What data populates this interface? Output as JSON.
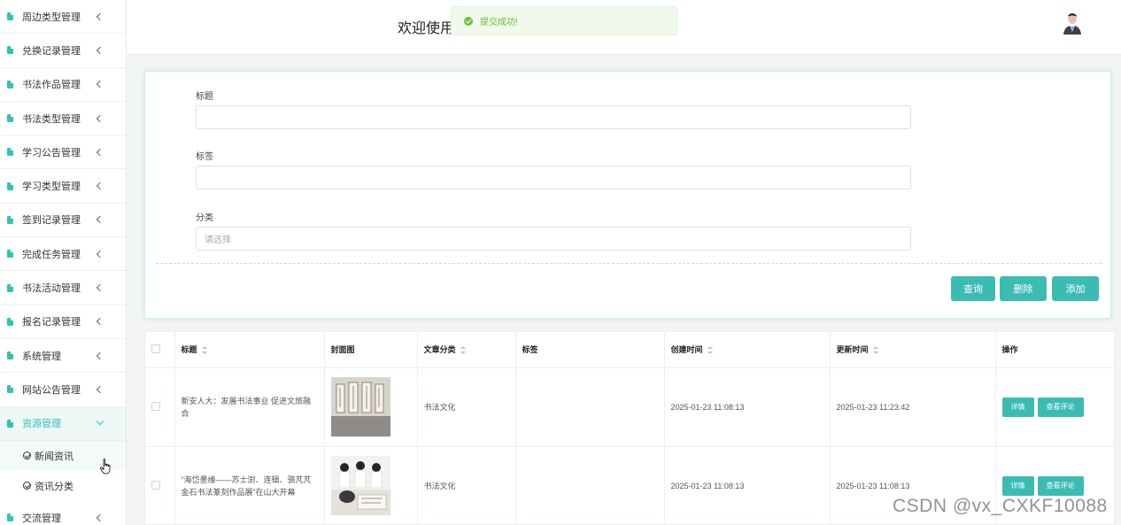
{
  "sidebar": {
    "items": [
      {
        "label": "周边类型管理"
      },
      {
        "label": "兑换记录管理"
      },
      {
        "label": "书法作品管理"
      },
      {
        "label": "书法类型管理"
      },
      {
        "label": "学习公告管理"
      },
      {
        "label": "学习类型管理"
      },
      {
        "label": "签到记录管理"
      },
      {
        "label": "完成任务管理"
      },
      {
        "label": "书法活动管理"
      },
      {
        "label": "报名记录管理"
      },
      {
        "label": "系统管理"
      },
      {
        "label": "网站公告管理"
      },
      {
        "label": "资源管理"
      },
      {
        "label": "交流管理"
      }
    ],
    "sub_items": [
      {
        "label": "新闻资讯"
      },
      {
        "label": "资讯分类"
      }
    ]
  },
  "header": {
    "welcome": "欢迎使用",
    "toast": "提交成功!"
  },
  "search": {
    "title_label": "标题",
    "tag_label": "标签",
    "category_label": "分类",
    "category_placeholder": "请选择",
    "query_button": "查询",
    "delete_button": "删除",
    "add_button": "添加"
  },
  "table": {
    "columns": [
      "标题",
      "封面图",
      "文章分类",
      "标签",
      "创建时间",
      "更新时间",
      "操作"
    ],
    "rows": [
      {
        "title": "新安人大：发展书法事业 促进文旅融合",
        "category": "书法文化",
        "tag": "",
        "created": "2025-01-23 11:08:13",
        "updated": "2025-01-23 11:23:42"
      },
      {
        "title": "“海岱墨缘——苏士澍、连辑、骆芃芃金石书法篆刻作品展”在山大开幕",
        "category": "书法文化",
        "tag": "",
        "created": "2025-01-23 11:08:13",
        "updated": "2025-01-23 11:08:13"
      }
    ],
    "detail_button": "详情",
    "comment_button": "查看评论"
  },
  "watermark": "CSDN @vx_CXKF10088",
  "colors": {
    "accent": "#3bbcb2",
    "success": "#67c23a"
  }
}
